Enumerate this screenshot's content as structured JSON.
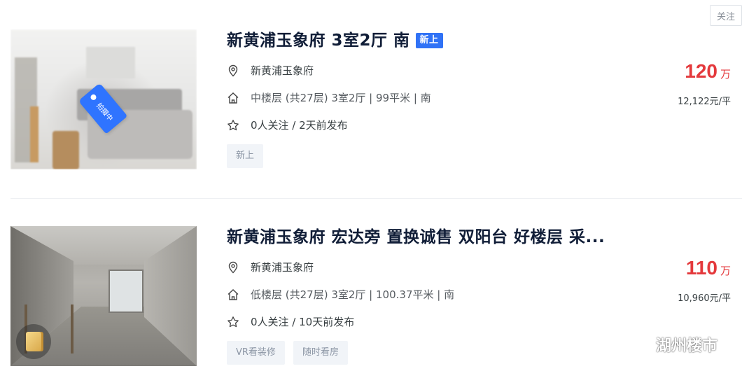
{
  "follow_label": "关注",
  "listings": [
    {
      "title": "新黄浦玉象府 3室2厅 南",
      "badge": "新上",
      "photo_tag": "拍摄中",
      "community": "新黄浦玉象府",
      "house_info": "中楼层 (共27层) 3室2厅 | 99平米 | 南",
      "follow_info": "0人关注 / 2天前发布",
      "tags": [
        "新上"
      ],
      "price": "120",
      "price_unit": "万",
      "unit_price": "12,122元/平"
    },
    {
      "title": "新黄浦玉象府 宏达旁 置换诚售 双阳台 好楼层 采...",
      "community": "新黄浦玉象府",
      "house_info": "低楼层 (共27层) 3室2厅 | 100.37平米 | 南",
      "follow_info": "0人关注 / 10天前发布",
      "tags": [
        "VR看装修",
        "随时看房"
      ],
      "price": "110",
      "price_unit": "万",
      "unit_price": "10,960元/平"
    }
  ],
  "watermark": "湖州楼市",
  "colors": {
    "price": "#e4393c",
    "badge": "#3072f6",
    "title": "#101d37",
    "chip_bg": "#f1f4f8"
  }
}
